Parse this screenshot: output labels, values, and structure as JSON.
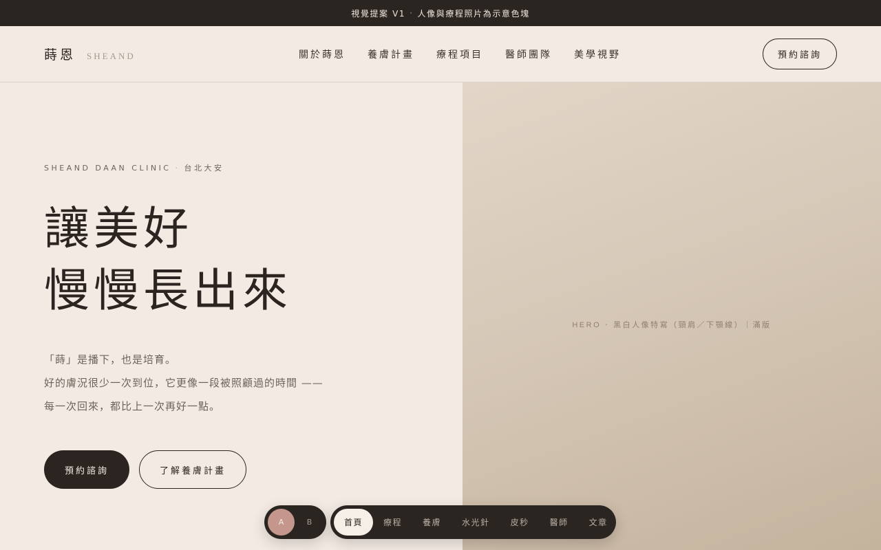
{
  "announcement": {
    "prefix": "視覺提案 V1",
    "separator": "·",
    "text": "人像與療程照片為示意色塊"
  },
  "header": {
    "brand_cn": "蒔恩",
    "brand_en": "SHEAND",
    "nav": [
      "關於蒔恩",
      "養膚計畫",
      "療程項目",
      "醫師團隊",
      "美學視野"
    ],
    "cta": "預約諮詢"
  },
  "hero": {
    "eyebrow_en": "SHEAND DAAN CLINIC",
    "eyebrow_sep": "·",
    "eyebrow_cn": "台北大安",
    "headline": [
      "讓美好",
      "慢慢長出來"
    ],
    "body": [
      "「蒔」是播下，也是培育。",
      "好的膚況很少一次到位，它更像一段被照顧過的時間 ——",
      "每一次回來，都比上一次再好一點。"
    ],
    "primary_button": "預約諮詢",
    "secondary_button": "了解養膚計畫",
    "image_placeholder_en": "HERO",
    "image_placeholder_sep": "·",
    "image_placeholder_cn": "黑白人像特寫（頸肩／下顎線）｜滿版"
  },
  "variant_switch": {
    "a": "A",
    "b": "B",
    "selected": "A"
  },
  "bottom_nav": {
    "items": [
      "首頁",
      "療程",
      "養膚",
      "水光針",
      "皮秒",
      "醫師",
      "文章"
    ],
    "active": "首頁"
  },
  "colors": {
    "page_bg": "#f3ebe3",
    "dark": "#2b2420",
    "accent_rose": "#c4968c",
    "hero_image_tone": "#d6c8b7"
  }
}
